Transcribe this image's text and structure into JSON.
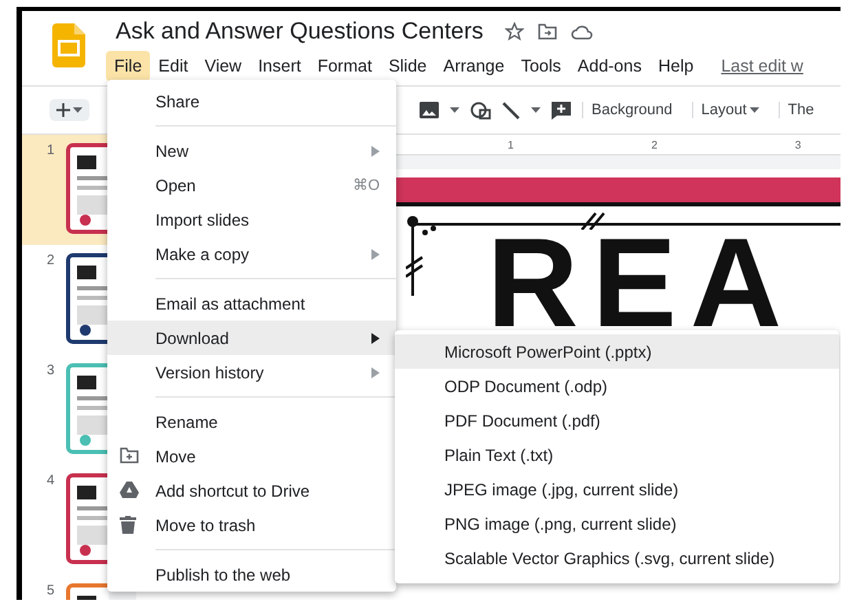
{
  "document": {
    "title": "Ask and Answer Questions Centers",
    "last_edit": "Last edit w"
  },
  "menu_bar": [
    {
      "label": "File",
      "selected": true
    },
    {
      "label": "Edit",
      "selected": false
    },
    {
      "label": "View",
      "selected": false
    },
    {
      "label": "Insert",
      "selected": false
    },
    {
      "label": "Format",
      "selected": false
    },
    {
      "label": "Slide",
      "selected": false
    },
    {
      "label": "Arrange",
      "selected": false
    },
    {
      "label": "Tools",
      "selected": false
    },
    {
      "label": "Add-ons",
      "selected": false
    },
    {
      "label": "Help",
      "selected": false
    }
  ],
  "toolbar": [
    {
      "kind": "text",
      "label": "Background"
    },
    {
      "kind": "dropdown",
      "label": "Layout"
    },
    {
      "kind": "text",
      "label": "The"
    }
  ],
  "ruler": [
    "1",
    "2",
    "3"
  ],
  "slides": [
    {
      "number": "1",
      "selected": true,
      "color": "#c8304f"
    },
    {
      "number": "2",
      "selected": false,
      "color": "#1f3a6e"
    },
    {
      "number": "3",
      "selected": false,
      "color": "#4bbfb3"
    },
    {
      "number": "4",
      "selected": false,
      "color": "#c8304f"
    },
    {
      "number": "5",
      "selected": false,
      "color": "#e8772e"
    }
  ],
  "slide_text": "REA",
  "file_menu": [
    [
      {
        "label": "Share",
        "kind": "text",
        "submenu": false,
        "selected": false
      }
    ],
    [
      {
        "label": "New",
        "kind": "text",
        "submenu": true,
        "selected": false
      },
      {
        "label": "Open",
        "kind": "text",
        "submenu": false,
        "selected": false,
        "shortcut": "⌘O"
      },
      {
        "label": "Import slides",
        "kind": "text",
        "submenu": false,
        "selected": false
      },
      {
        "label": "Make a copy",
        "kind": "text",
        "submenu": true,
        "selected": false
      }
    ],
    [
      {
        "label": "Email as attachment",
        "kind": "text",
        "submenu": false,
        "selected": false
      },
      {
        "label": "Download",
        "kind": "text",
        "submenu": true,
        "selected": true
      },
      {
        "label": "Version history",
        "kind": "text",
        "submenu": true,
        "selected": false
      }
    ],
    [
      {
        "label": "Rename",
        "kind": "text",
        "submenu": false,
        "selected": false
      },
      {
        "label": "Move",
        "kind": "folder",
        "submenu": false,
        "selected": false
      },
      {
        "label": "Add shortcut to Drive",
        "kind": "drive",
        "submenu": false,
        "selected": false
      },
      {
        "label": "Move to trash",
        "kind": "trash",
        "submenu": false,
        "selected": false
      }
    ],
    [
      {
        "label": "Publish to the web",
        "kind": "text",
        "submenu": false,
        "selected": false
      }
    ]
  ],
  "download_menu": [
    {
      "label": "Microsoft PowerPoint (.pptx)",
      "selected": true
    },
    {
      "label": "ODP Document (.odp)",
      "selected": false
    },
    {
      "label": "PDF Document (.pdf)",
      "selected": false
    },
    {
      "label": "Plain Text (.txt)",
      "selected": false
    },
    {
      "label": "JPEG image (.jpg, current slide)",
      "selected": false
    },
    {
      "label": "PNG image (.png, current slide)",
      "selected": false
    },
    {
      "label": "Scalable Vector Graphics (.svg, current slide)",
      "selected": false
    }
  ]
}
